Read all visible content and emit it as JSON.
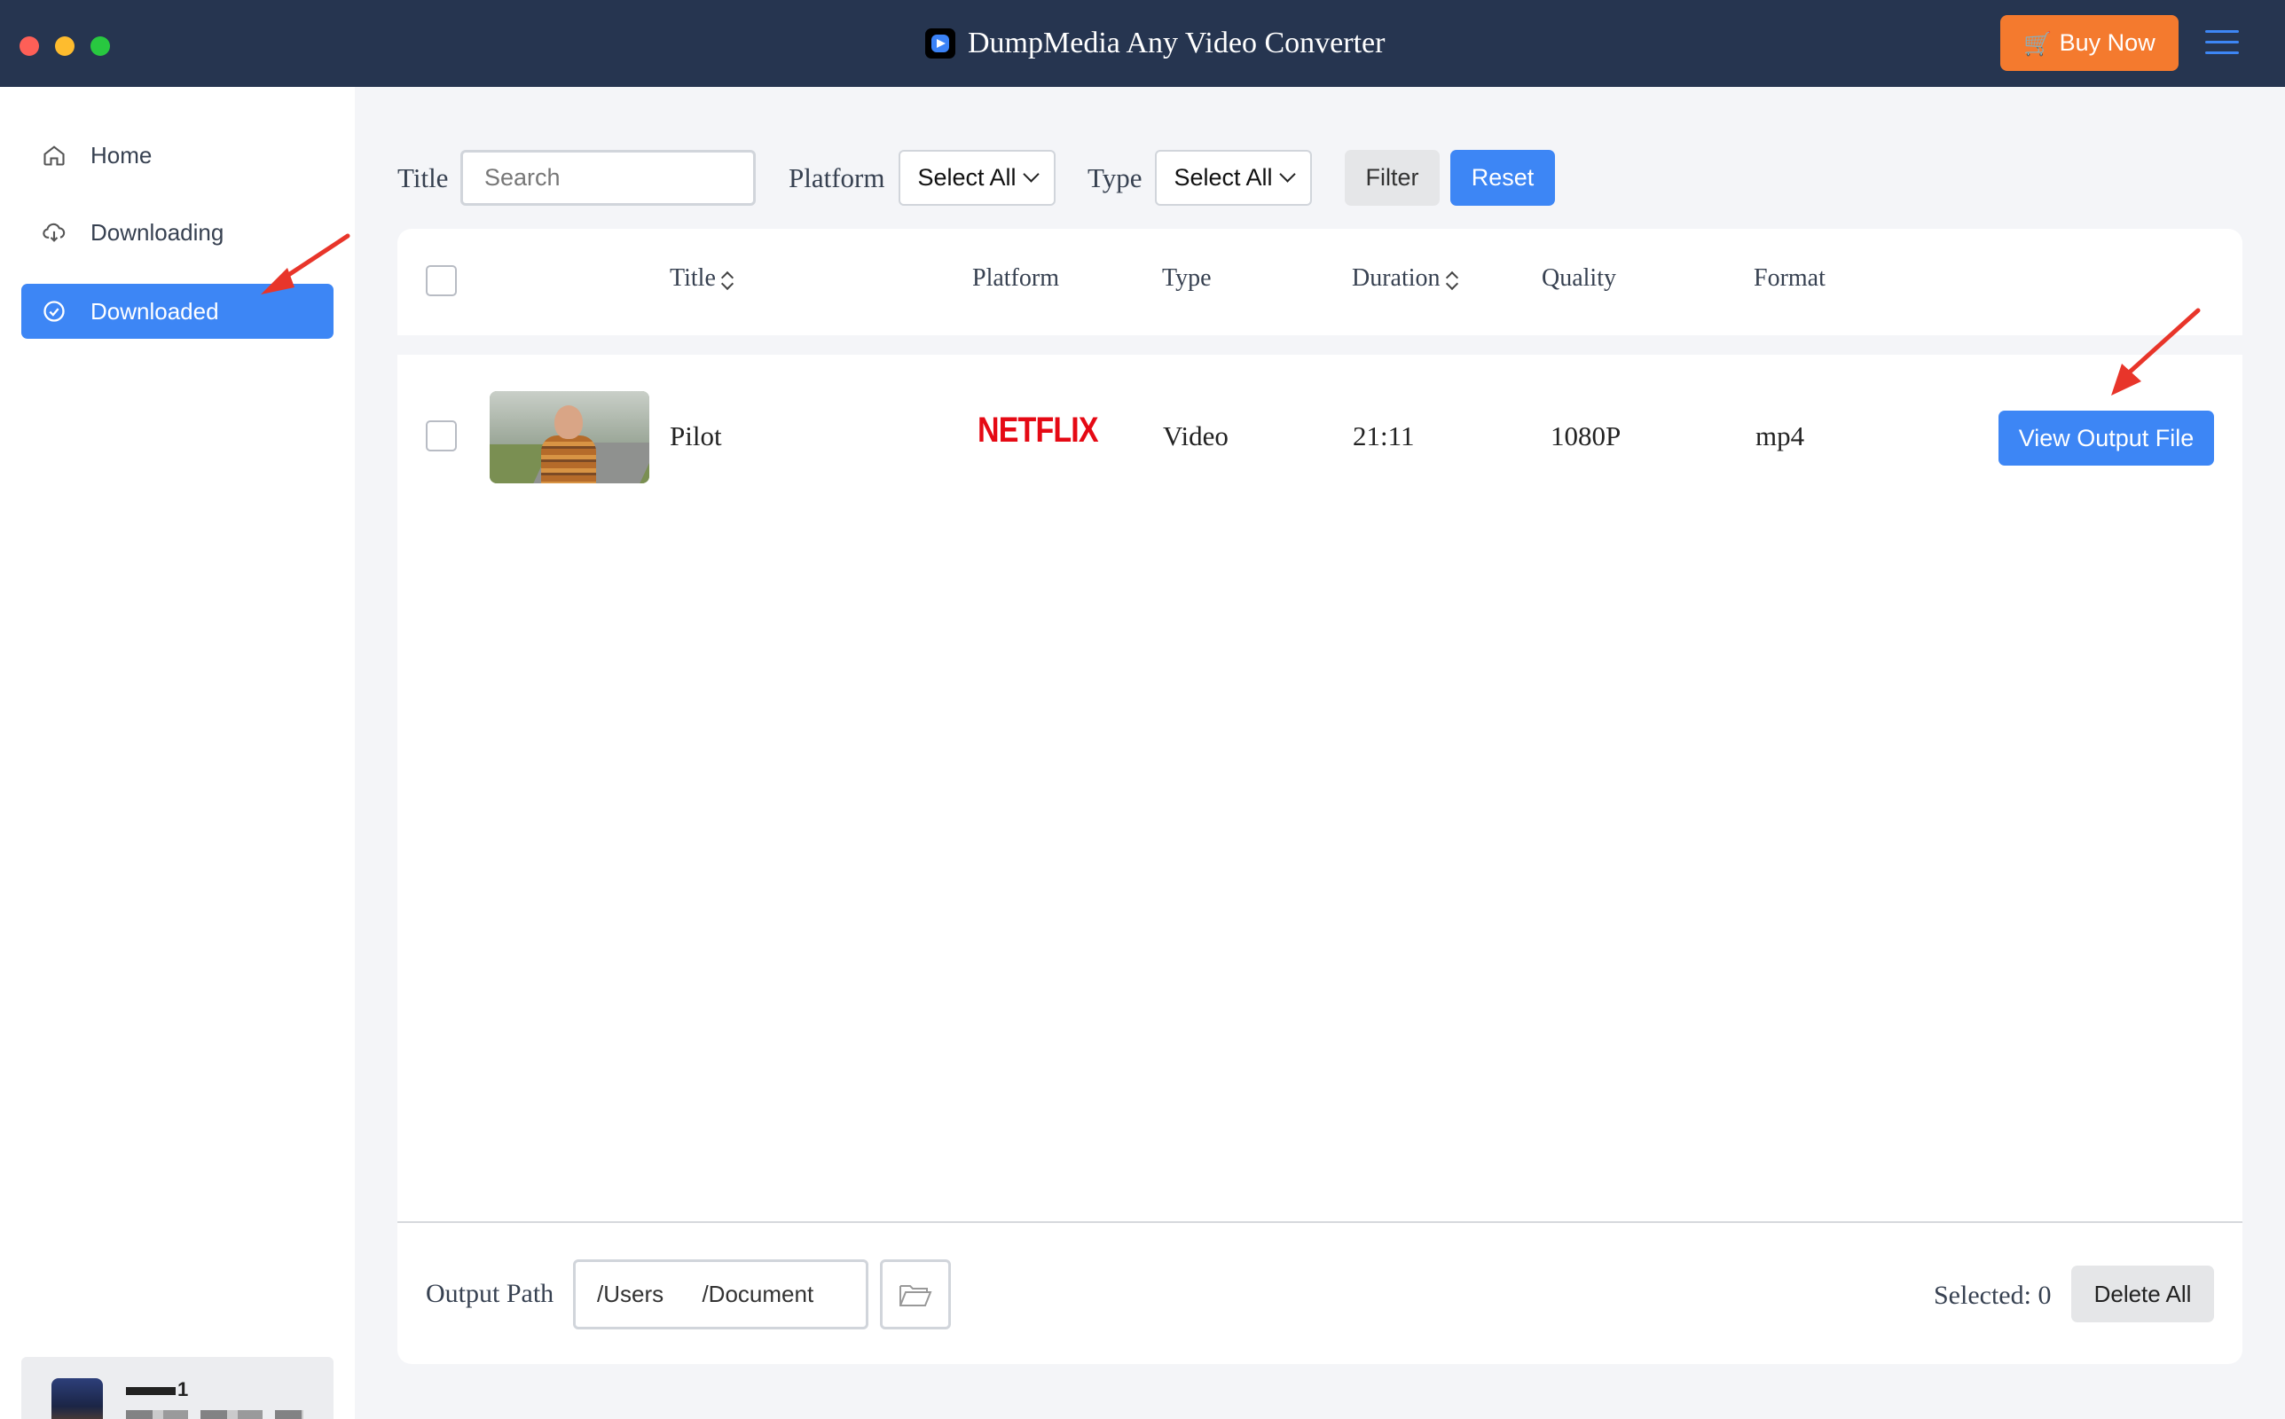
{
  "window": {
    "title": "DumpMedia Any Video Converter",
    "buy_label": "Buy Now"
  },
  "sidebar": {
    "items": [
      {
        "label": "Home",
        "icon": "home-icon",
        "active": false
      },
      {
        "label": "Downloading",
        "icon": "cloud-download-icon",
        "active": false
      },
      {
        "label": "Downloaded",
        "icon": "check-circle-icon",
        "active": true
      }
    ],
    "user": {
      "name": "1"
    }
  },
  "filters": {
    "title_label": "Title",
    "search_placeholder": "Search",
    "platform_label": "Platform",
    "platform_value": "Select All",
    "type_label": "Type",
    "type_value": "Select All",
    "filter_label": "Filter",
    "reset_label": "Reset"
  },
  "table": {
    "headers": {
      "title": "Title",
      "platform": "Platform",
      "type": "Type",
      "duration": "Duration",
      "quality": "Quality",
      "format": "Format"
    },
    "rows": [
      {
        "title": "Pilot",
        "platform": "NETFLIX",
        "type": "Video",
        "duration": "21:11",
        "quality": "1080P",
        "format": "mp4",
        "action": "View Output File",
        "checked": false
      }
    ]
  },
  "footer": {
    "output_label": "Output Path",
    "output_path": "/Users      /Document",
    "selected_text": "Selected: 0",
    "delete_label": "Delete All"
  },
  "colors": {
    "titlebar": "#263550",
    "accent": "#3d86f5",
    "buy": "#f47a2e",
    "annotation": "#e8352a",
    "netflix": "#e50914"
  }
}
